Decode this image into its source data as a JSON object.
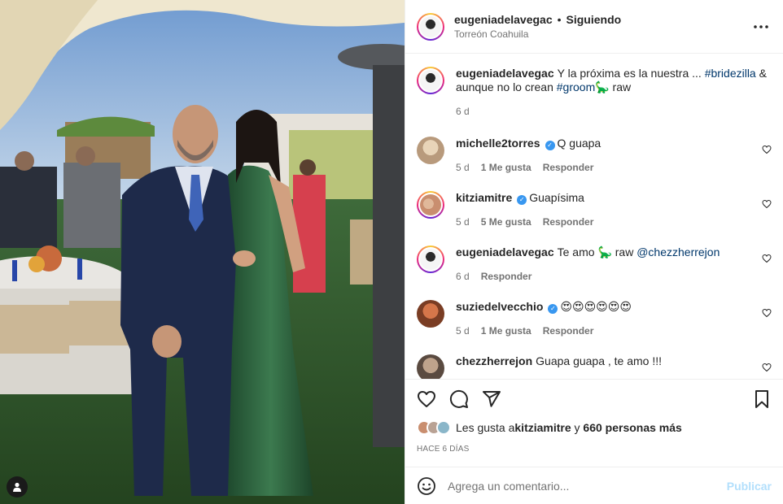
{
  "header": {
    "username": "eugeniadelavegac",
    "separator": "•",
    "follow_status": "Siguiendo",
    "location": "Torreón Coahuila",
    "more_label": "···"
  },
  "caption": {
    "username": "eugeniadelavegac",
    "text_before": "Y la próxima es la nuestra ... ",
    "hashtag1": "#bridezilla",
    "text_mid": " & aunque no lo crean ",
    "hashtag2": "#groom",
    "emoji": "🦕",
    "text_after": " raw",
    "age": "6 d"
  },
  "comments": [
    {
      "username": "michelle2torres",
      "verified": true,
      "text": "Q guapa",
      "age": "5 d",
      "likes": "1 Me gusta",
      "reply": "Responder"
    },
    {
      "username": "kitziamitre",
      "verified": true,
      "text": "Guapísima",
      "age": "5 d",
      "likes": "5 Me gusta",
      "reply": "Responder"
    },
    {
      "username": "eugeniadelavegac",
      "verified": false,
      "text": "Te amo ",
      "emoji": "🦕",
      "text2": " raw ",
      "mention": "@chezzherrejon",
      "age": "6 d",
      "reply": "Responder"
    },
    {
      "username": "suziedelvecchio",
      "verified": true,
      "text": "😍😍😍😍😍😍",
      "age": "5 d",
      "likes": "1 Me gusta",
      "reply": "Responder"
    },
    {
      "username": "chezzherrejon",
      "verified": false,
      "text": "Guapa guapa , te amo !!!"
    }
  ],
  "likes": {
    "prefix": "Les gusta a ",
    "user": "kitziamitre",
    "connector": " y ",
    "others": "660 personas más"
  },
  "date": "HACE 6 DÍAS",
  "add_comment": {
    "placeholder": "Agrega un comentario...",
    "publish_label": "Publicar"
  },
  "icons": {
    "like": "heart-icon",
    "comment": "comment-icon",
    "share": "paper-plane-icon",
    "save": "bookmark-icon",
    "emoji": "smiley-icon",
    "user_tags": "person-icon",
    "more": "ellipsis-icon"
  },
  "colors": {
    "link": "#00376b",
    "verified": "#3897f0",
    "publish_disabled": "#b2dffc",
    "muted_text": "#737373"
  }
}
